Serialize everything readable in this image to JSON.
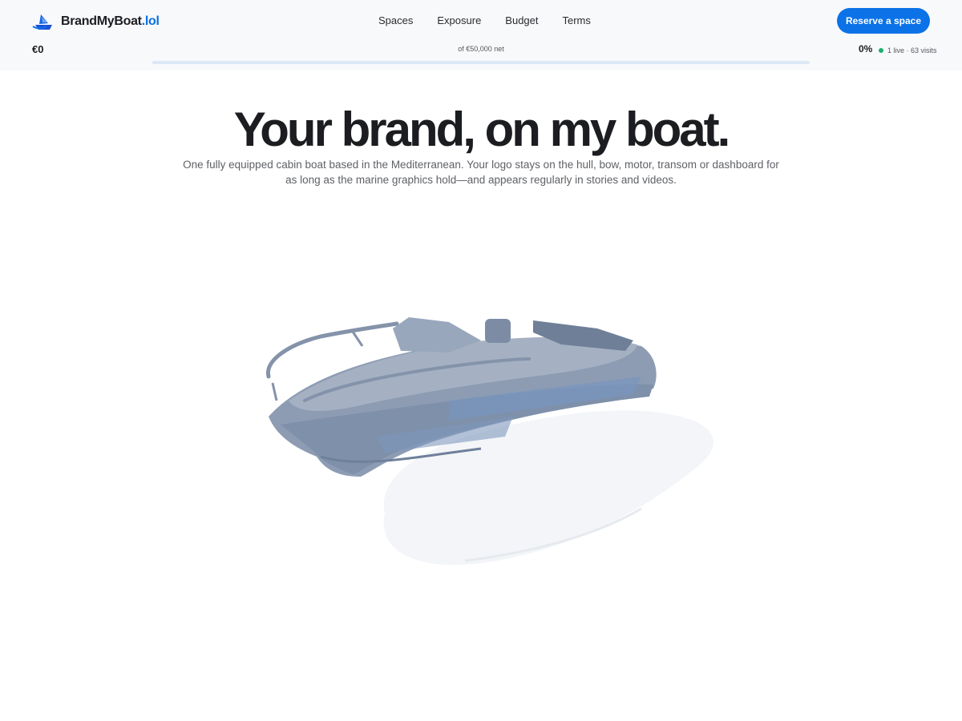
{
  "brand": {
    "name": "BrandMyBoat",
    "tld": ".lol",
    "icon": "boat-logo-icon"
  },
  "nav": {
    "items": [
      "Spaces",
      "Exposure",
      "Budget",
      "Terms"
    ]
  },
  "cta": {
    "label": "Reserve a space"
  },
  "funding": {
    "raised": "€0",
    "goal": "of €50,000 net",
    "percent": "0%",
    "progress_fraction": 0,
    "live_stats": "1 live · 63 visits"
  },
  "hero": {
    "title": "Your brand, on my boat.",
    "subtitle": "One fully equipped cabin boat based in the Mediterranean. Your logo stays on the hull, bow, motor, transom or dashboard for as long as the marine graphics hold—and appears regularly in stories and videos."
  },
  "colors": {
    "accent": "#0b72e7",
    "live": "#16b26b",
    "boat": "#8b9bb2",
    "shadow": "#f2f4f7"
  }
}
